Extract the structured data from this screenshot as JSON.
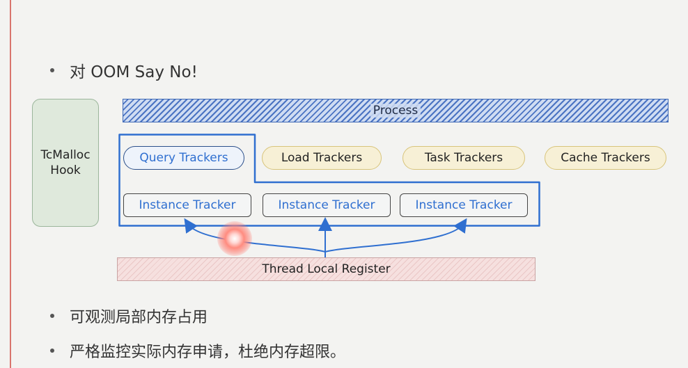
{
  "bullets": {
    "title": "对 OOM Say No!",
    "point_1": "可观测局部内存占用",
    "point_2": "严格监控实际内存申请，杜绝内存超限。"
  },
  "diagram": {
    "hook_label": "TcMalloc\nHook",
    "process_label": "Process",
    "trackers": {
      "query": "Query Trackers",
      "load": "Load Trackers",
      "task": "Task Trackers",
      "cache": "Cache Trackers"
    },
    "instances": [
      "Instance Tracker",
      "Instance Tracker",
      "Instance Tracker"
    ],
    "register_label": "Thread Local Register"
  },
  "colors": {
    "accent_blue": "#2f6fd0",
    "process_hatch": "#4a73c2",
    "hook_green": "#dfe9dc",
    "tracker_tan": "#f7f0d6",
    "register_pink": "#f6e0df",
    "margin_red": "#d9756d"
  }
}
